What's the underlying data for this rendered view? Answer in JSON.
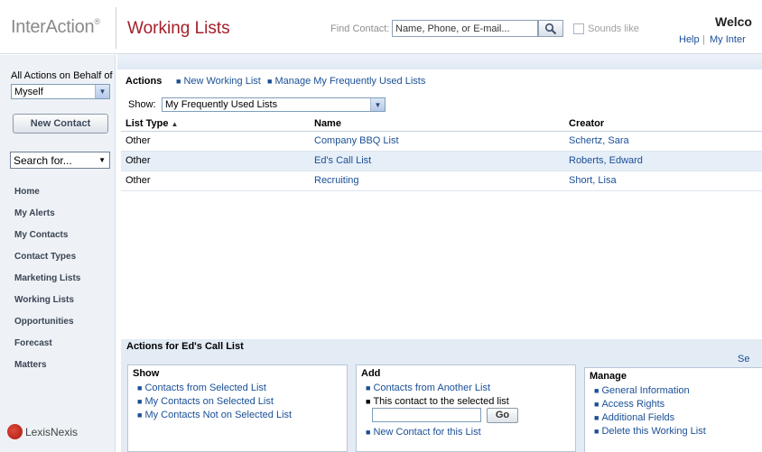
{
  "header": {
    "logo_text": "InterAction",
    "logo_mark": "®",
    "page_title": "Working Lists",
    "find_label": "Find Contact:",
    "find_placeholder": "Name, Phone, or E-mail...",
    "sounds_like_label": "Sounds like",
    "welcome_text": "Welco",
    "help_link": "Help",
    "separator": "|",
    "my_inter_link": "My Inter"
  },
  "sidebar": {
    "behalf_label": "All Actions on Behalf of",
    "behalf_value": "Myself",
    "new_contact_label": "New Contact",
    "search_value": "Search for...",
    "nav_items": [
      {
        "label": "Home"
      },
      {
        "label": "My Alerts"
      },
      {
        "label": "My Contacts"
      },
      {
        "label": "Contact Types"
      },
      {
        "label": "Marketing Lists"
      },
      {
        "label": "Working Lists"
      },
      {
        "label": "Opportunities"
      },
      {
        "label": "Forecast"
      },
      {
        "label": "Matters"
      }
    ],
    "brand_text": "LexisNexis"
  },
  "actions": {
    "title": "Actions",
    "new_working_list": "New Working List",
    "manage_frequent": "Manage My Frequently Used Lists"
  },
  "show": {
    "label": "Show:",
    "value": "My Frequently Used Lists"
  },
  "table": {
    "columns": [
      "List Type",
      "Name",
      "Creator"
    ],
    "sort_indicator": "▲",
    "rows": [
      {
        "type": "Other",
        "name": "Company BBQ List",
        "creator": "Schertz, Sara"
      },
      {
        "type": "Other",
        "name": "Ed's Call List",
        "creator": "Roberts, Edward"
      },
      {
        "type": "Other",
        "name": "Recruiting",
        "creator": "Short, Lisa"
      }
    ]
  },
  "bottom": {
    "title": "Actions for Ed's Call List",
    "see_link": "Se",
    "show_panel": {
      "title": "Show",
      "items": [
        "Contacts from Selected List",
        "My Contacts on Selected List",
        "My Contacts Not on Selected List"
      ]
    },
    "add_panel": {
      "title": "Add",
      "item1": "Contacts from Another List",
      "item2": "This contact to the selected list",
      "go_label": "Go",
      "item3": "New Contact for this List"
    },
    "manage_panel": {
      "title": "Manage",
      "items": [
        "General Information",
        "Access Rights",
        "Additional Fields",
        "Delete this Working List"
      ]
    }
  },
  "colors": {
    "title_red": "#a31f2a",
    "link_blue": "#1a4f96",
    "selected_row": "#e6eef8"
  }
}
